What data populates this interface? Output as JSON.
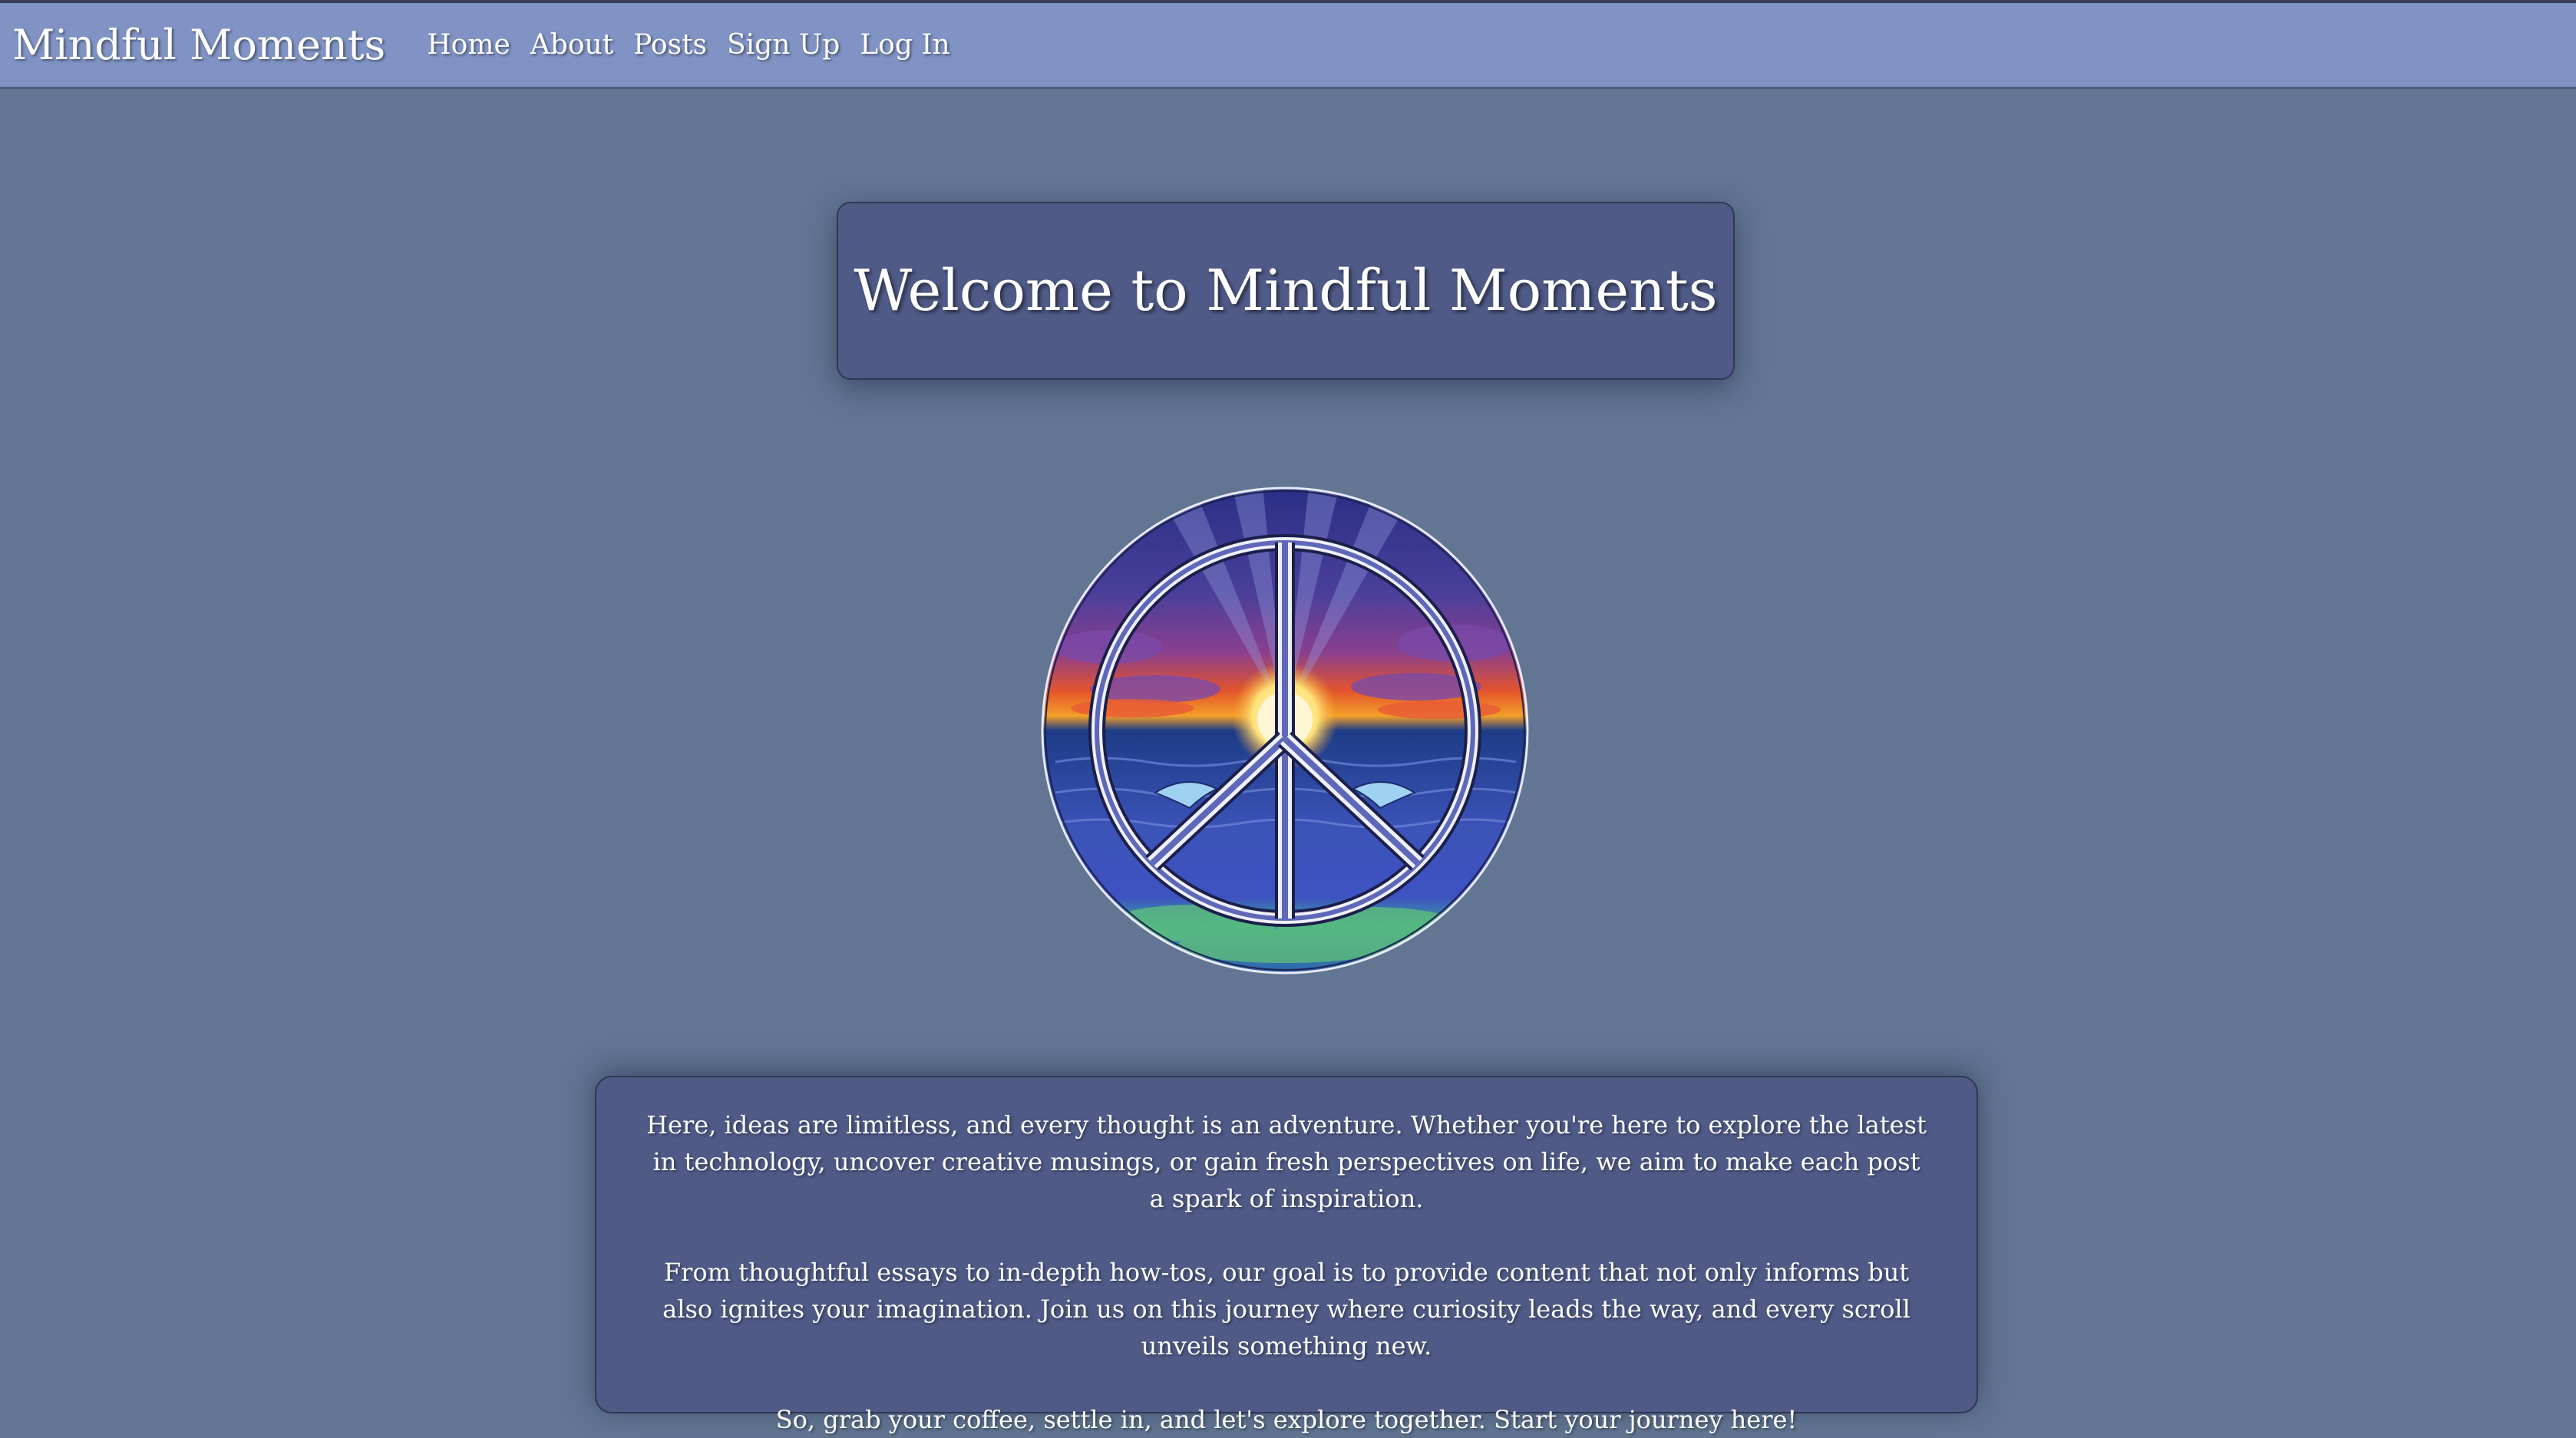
{
  "site": {
    "brand": "Mindful Moments"
  },
  "nav": {
    "items": [
      {
        "label": "Home"
      },
      {
        "label": "About"
      },
      {
        "label": "Posts"
      },
      {
        "label": "Sign Up"
      },
      {
        "label": "Log In"
      }
    ]
  },
  "hero": {
    "title": "Welcome to Mindful Moments"
  },
  "image": {
    "icon": "peace-sign-artwork"
  },
  "intro": {
    "paragraphs": [
      "Here, ideas are limitless, and every thought is an adventure. Whether you're here to explore the latest in technology, uncover creative musings, or gain fresh perspectives on life, we aim to make each post a spark of inspiration.",
      "From thoughtful essays to in-depth how-tos, our goal is to provide content that not only informs but also ignites your imagination. Join us on this journey where curiosity leads the way, and every scroll unveils something new.",
      "So, grab your coffee, settle in, and let's explore together. Start your journey here!"
    ]
  },
  "colors": {
    "page_bg": "#627694",
    "navbar_bg": "#8093c4",
    "card_bg": "#4f5a87"
  }
}
